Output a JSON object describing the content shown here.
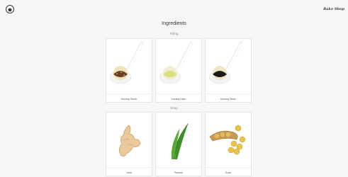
{
  "header": {
    "brand": "Bake Shop"
  },
  "page": {
    "title": "Ingredients"
  },
  "sections": [
    {
      "label": "Filling",
      "items": [
        {
          "label": "Kacang Tanah",
          "icon": "peanut-filling-spoon"
        },
        {
          "label": "Kacang Hijau",
          "icon": "mung-bean-filling-spoon"
        },
        {
          "label": "Kacang Hitam",
          "icon": "black-bean-filling-spoon"
        }
      ]
    },
    {
      "label": "Soup",
      "items": [
        {
          "label": "Jahe",
          "icon": "ginger-root"
        },
        {
          "label": "Pandan",
          "icon": "pandan-leaves"
        },
        {
          "label": "Soya",
          "icon": "soybeans"
        }
      ]
    }
  ]
}
